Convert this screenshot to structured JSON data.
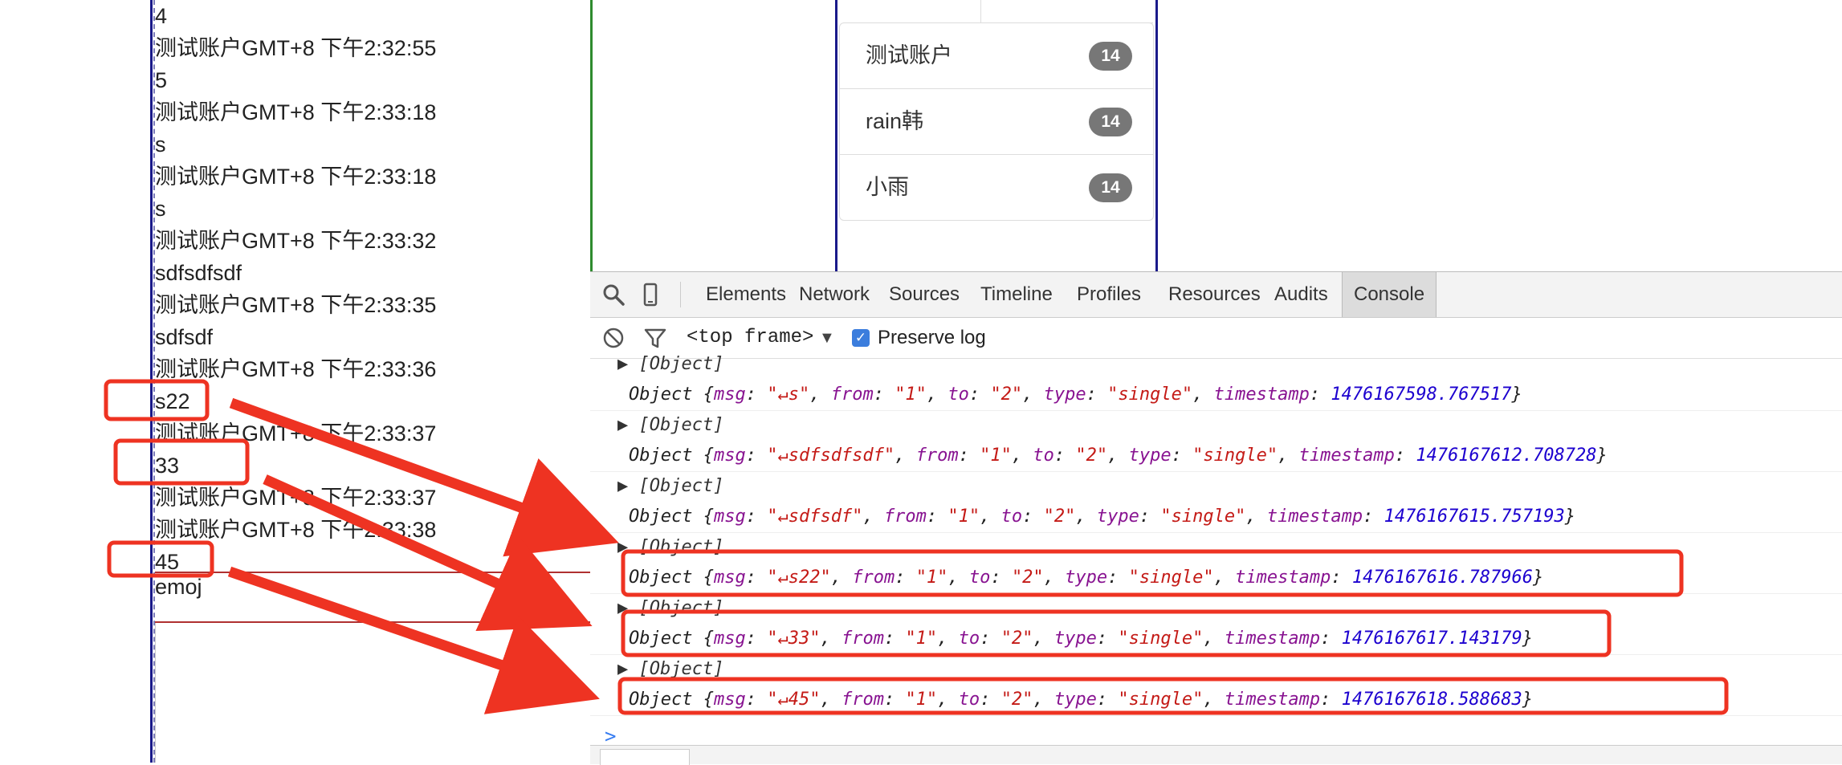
{
  "chat": {
    "messages": [
      "4",
      "测试账户GMT+8 下午2:32:55",
      "5",
      "测试账户GMT+8 下午2:33:18",
      "s",
      "测试账户GMT+8 下午2:33:18",
      "s",
      "测试账户GMT+8 下午2:33:32",
      "sdfsdfsdf",
      "测试账户GMT+8 下午2:33:35",
      "sdfsdf",
      "测试账户GMT+8 下午2:33:36",
      "s22",
      "测试账户GMT+8 下午2:33:37",
      "33",
      "测试账户GMT+8 下午2:33:37",
      "测试账户GMT+8 下午2:33:38",
      "45"
    ],
    "input_line": "emoj"
  },
  "contacts": [
    {
      "name": "测试账户",
      "badge": "14"
    },
    {
      "name": "rain韩",
      "badge": "14"
    },
    {
      "name": "小雨",
      "badge": "14"
    }
  ],
  "devtools": {
    "tabs": [
      "Elements",
      "Network",
      "Sources",
      "Timeline",
      "Profiles",
      "Resources",
      "Audits",
      "Console"
    ],
    "active_tab": "Console",
    "frame": "<top frame>",
    "preserve_log_label": "Preserve log",
    "preserve_log_checked": true,
    "array_label": "[Object]",
    "prompt": ">",
    "entries": [
      {
        "msg": "\"↵s\"",
        "from": "\"1\"",
        "to": "\"2\"",
        "type": "\"single\"",
        "timestamp": "1476167598.767517"
      },
      {
        "msg": "\"↵sdfsdfsdf\"",
        "from": "\"1\"",
        "to": "\"2\"",
        "type": "\"single\"",
        "timestamp": "1476167612.708728"
      },
      {
        "msg": "\"↵sdfsdf\"",
        "from": "\"1\"",
        "to": "\"2\"",
        "type": "\"single\"",
        "timestamp": "1476167615.757193"
      },
      {
        "msg": "\"↵s22\"",
        "from": "\"1\"",
        "to": "\"2\"",
        "type": "\"single\"",
        "timestamp": "1476167616.787966"
      },
      {
        "msg": "\"↵33\"",
        "from": "\"1\"",
        "to": "\"2\"",
        "type": "\"single\"",
        "timestamp": "1476167617.143179"
      },
      {
        "msg": "\"↵45\"",
        "from": "\"1\"",
        "to": "\"2\"",
        "type": "\"single\"",
        "timestamp": "1476167618.588683"
      }
    ]
  },
  "colors": {
    "annotation": "#ee3322",
    "keyword": "#881391",
    "string": "#c41a16",
    "number": "#1c00cf"
  }
}
